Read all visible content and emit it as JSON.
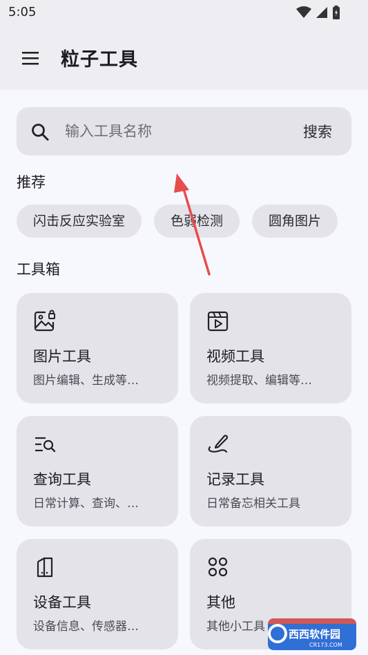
{
  "status_bar": {
    "time": "5:05",
    "icons": [
      "wifi-icon",
      "signal-icon",
      "battery-icon"
    ]
  },
  "app_bar": {
    "menu_icon": "hamburger-menu-icon",
    "title": "粒子工具"
  },
  "search": {
    "placeholder": "输入工具名称",
    "button_label": "搜索",
    "icon": "search-icon"
  },
  "recommended": {
    "heading": "推荐",
    "chips": [
      "闪击反应实验室",
      "色弱检测",
      "圆角图片"
    ]
  },
  "toolbox": {
    "heading": "工具箱",
    "cards": [
      {
        "title": "图片工具",
        "desc": "图片编辑、生成等…",
        "icon": "image-icon"
      },
      {
        "title": "视频工具",
        "desc": "视频提取、编辑等…",
        "icon": "video-icon"
      },
      {
        "title": "查询工具",
        "desc": "日常计算、查询、…",
        "icon": "search-list-icon"
      },
      {
        "title": "记录工具",
        "desc": "日常备忘相关工具",
        "icon": "pen-icon"
      },
      {
        "title": "设备工具",
        "desc": "设备信息、传感器…",
        "icon": "device-icon"
      },
      {
        "title": "其他",
        "desc": "其他小工具",
        "icon": "grid-dots-icon"
      }
    ]
  },
  "watermark": {
    "text": "西西软件园",
    "sub": "CR173.COM"
  },
  "colors": {
    "background": "#f7f8fe",
    "surface": "#e3e3e9",
    "appbar": "#eeeef2",
    "annotation_arrow": "#e84b4b"
  }
}
